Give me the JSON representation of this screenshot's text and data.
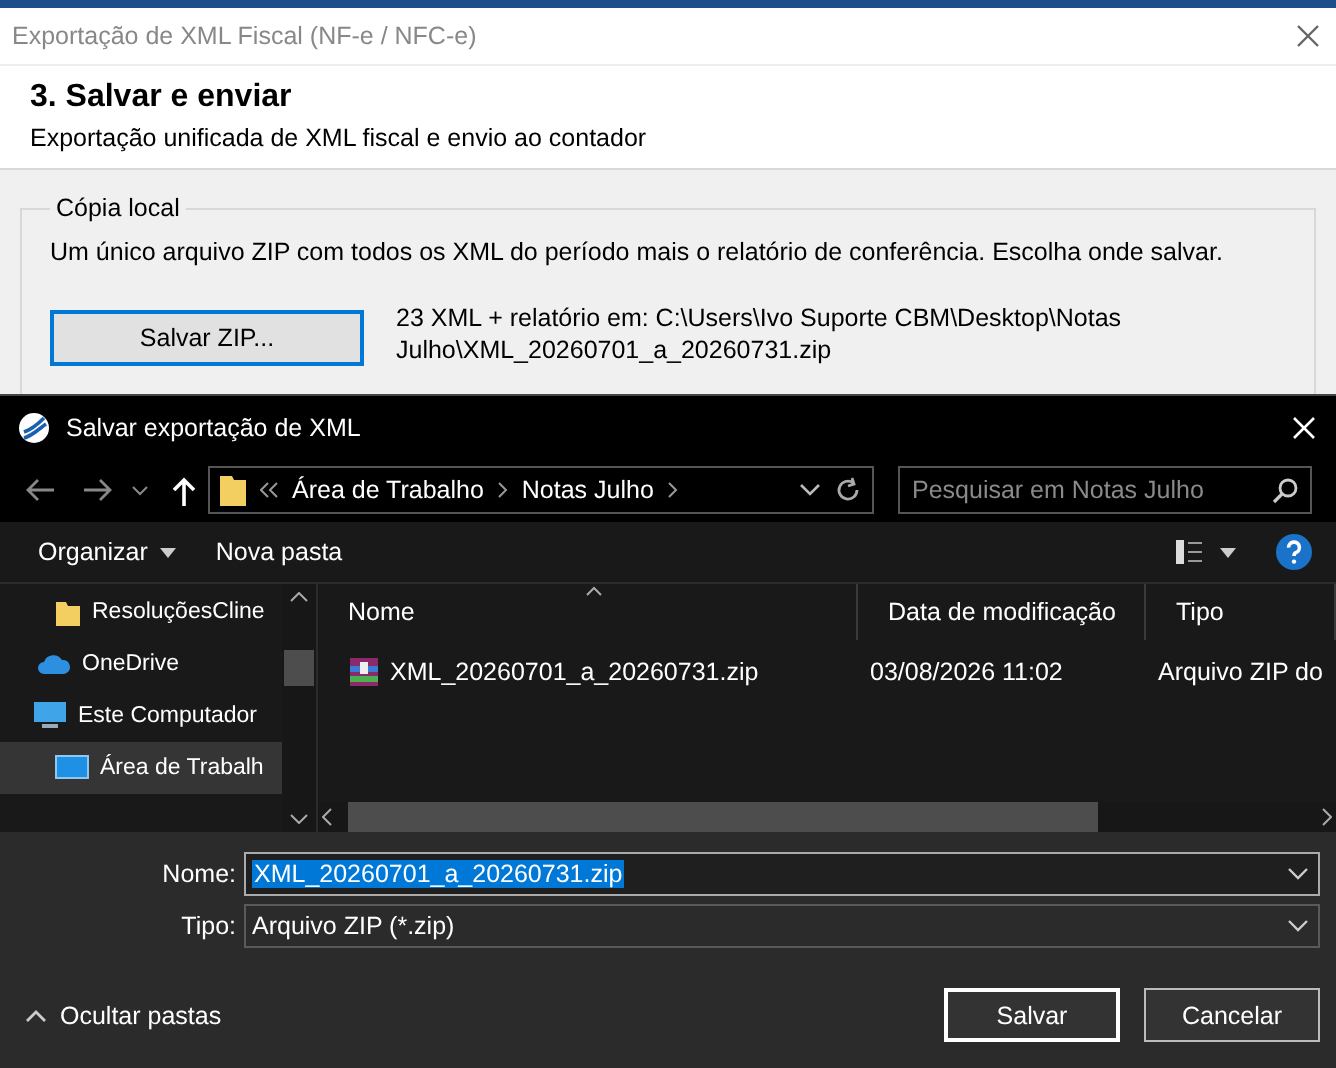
{
  "window": {
    "title": "Exportação de XML Fiscal (NF-e / NFC-e)"
  },
  "header": {
    "title": "3. Salvar e enviar",
    "subtitle": "Exportação unificada de XML fiscal e envio ao contador"
  },
  "local_copy": {
    "legend": "Cópia local",
    "description": "Um único arquivo ZIP com todos os XML do período mais o relatório de conferência. Escolha onde salvar.",
    "button": "Salvar ZIP...",
    "destination": "23 XML + relatório em: C:\\Users\\Ivo Suporte CBM\\Desktop\\Notas Julho\\XML_20260701_a_20260731.zip"
  },
  "save_dialog": {
    "title": "Salvar exportação de XML",
    "breadcrumb": [
      "Área de Trabalho",
      "Notas Julho"
    ],
    "search": {
      "placeholder": "Pesquisar em Notas Julho"
    },
    "toolbar": [
      {
        "label": "Organizar",
        "kind": "menu"
      },
      {
        "label": "Nova pasta",
        "kind": "button"
      }
    ],
    "nav_items": [
      {
        "label": "ResoluçõesCline",
        "kind": "folder",
        "selected": false
      },
      {
        "label": "OneDrive",
        "kind": "cloud",
        "selected": false
      },
      {
        "label": "Este Computador",
        "kind": "computer",
        "selected": false,
        "children": [
          {
            "label": "Área de Trabalh",
            "kind": "desktop",
            "selected": true
          }
        ]
      }
    ],
    "columns": [
      "Nome",
      "Data de modificação",
      "Tipo"
    ],
    "files": [
      {
        "name": "XML_20260701_a_20260731.zip",
        "modified": "03/08/2026 11:02",
        "type": "Arquivo ZIP do"
      }
    ],
    "filename": {
      "label": "Nome:",
      "value": "XML_20260701_a_20260731.zip",
      "selected": true
    },
    "filetype": {
      "label": "Tipo:",
      "value": "Arquivo ZIP (*.zip)"
    },
    "hide_folders": "Ocultar pastas",
    "buttons": [
      {
        "label": "Salvar",
        "kind": "primary"
      },
      {
        "label": "Cancelar",
        "kind": "secondary"
      }
    ]
  }
}
